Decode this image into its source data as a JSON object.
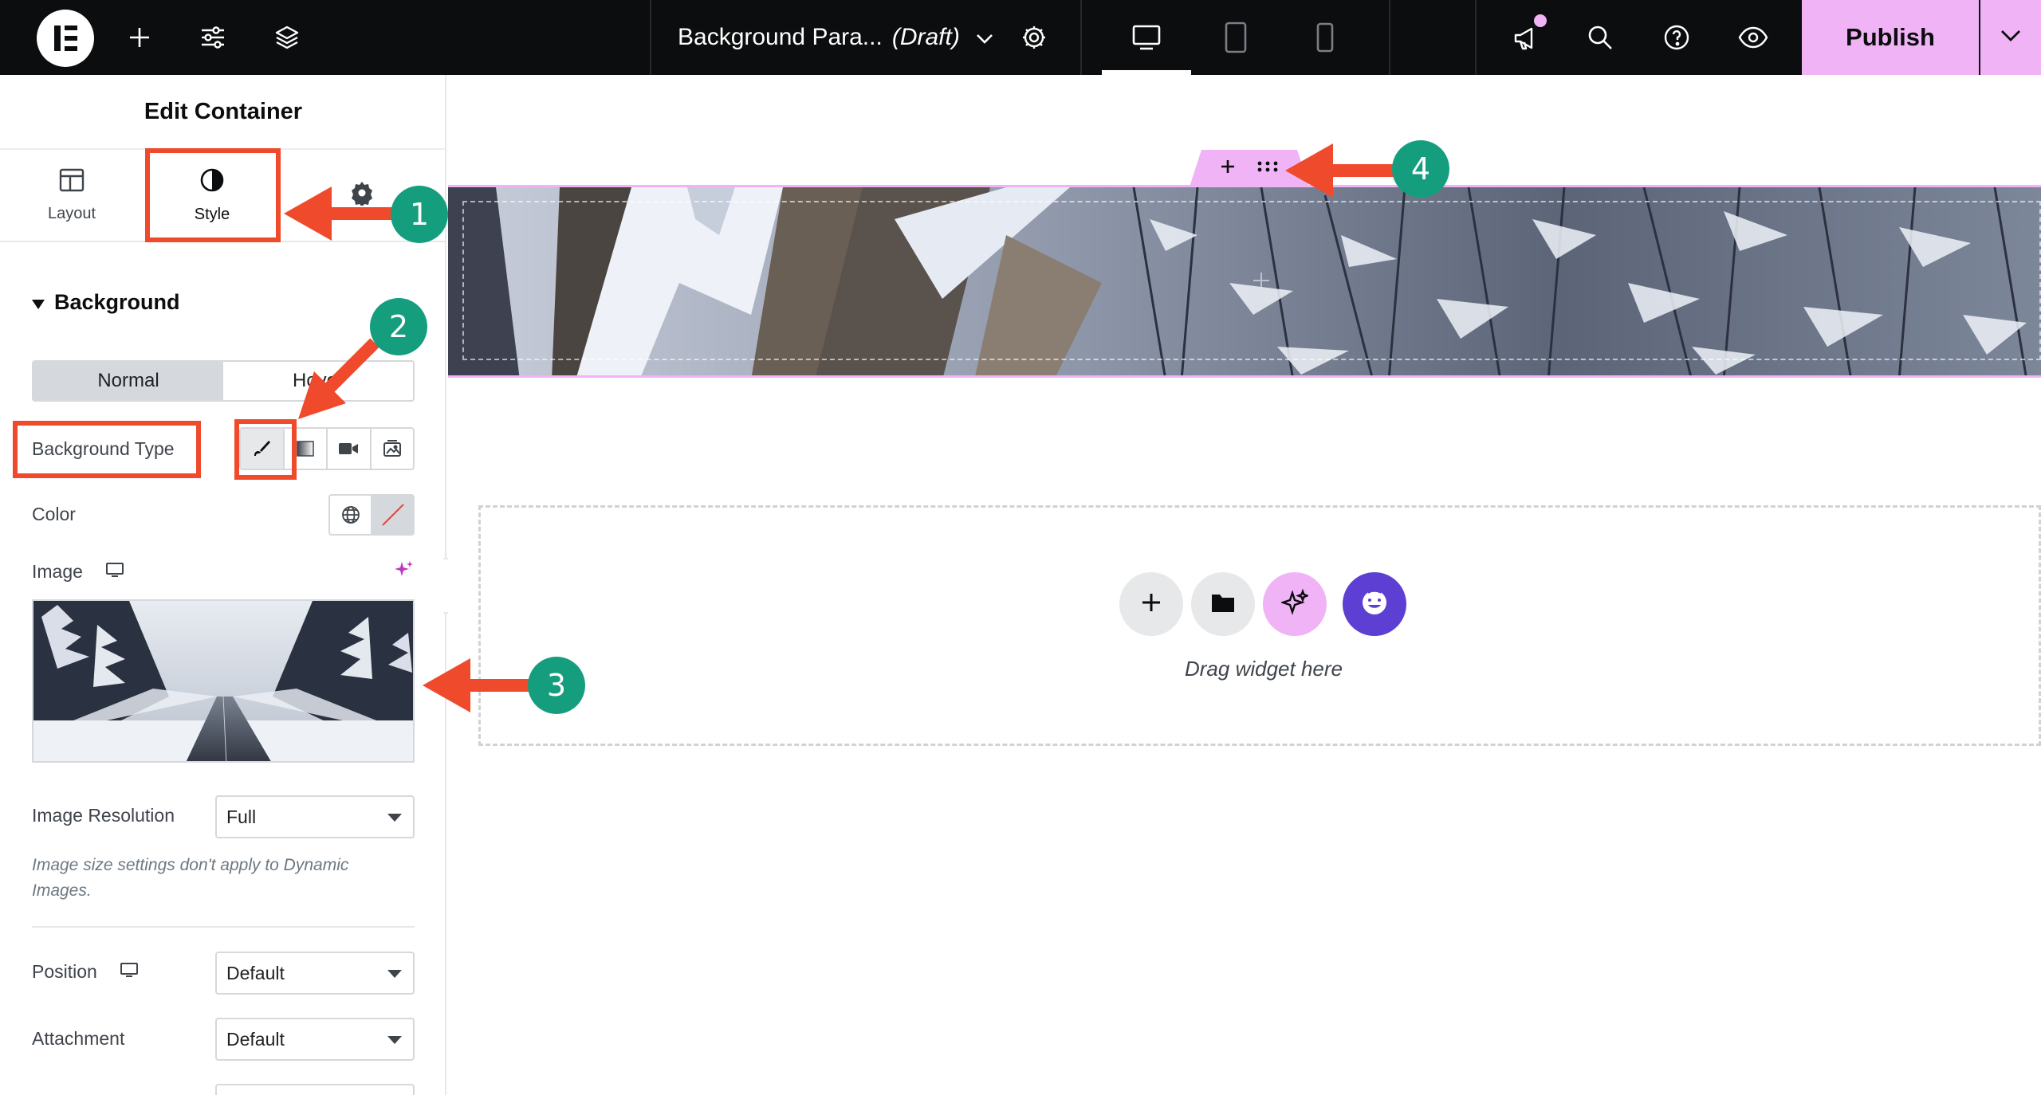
{
  "topbar": {
    "document_title": "Background Para...",
    "draft_label": "(Draft)",
    "publish_label": "Publish"
  },
  "panel": {
    "title": "Edit Container",
    "tabs": [
      {
        "label": "Layout",
        "icon": "layout-icon"
      },
      {
        "label": "Style",
        "icon": "contrast-icon"
      },
      {
        "label": "",
        "icon": "gear-icon"
      }
    ],
    "section": "Background",
    "state_switch": {
      "normal": "Normal",
      "hover": "Hover"
    },
    "background_type_label": "Background Type",
    "color_label": "Color",
    "image_label": "Image",
    "image_resolution_label": "Image Resolution",
    "image_resolution_value": "Full",
    "note": "Image size settings don't apply to Dynamic Images.",
    "position_label": "Position",
    "position_value": "Default",
    "attachment_label": "Attachment",
    "attachment_value": "Default"
  },
  "canvas": {
    "drop_text": "Drag widget here"
  },
  "annotations": {
    "badge_1": "1",
    "badge_2": "2",
    "badge_3": "3",
    "badge_4": "4"
  },
  "colors": {
    "topbar_bg": "#0c0d0e",
    "publish_bg": "#f0b4f6",
    "annotation_red": "#f04a2c",
    "badge_green": "#159e7e",
    "ai_purple": "#5d3fd3"
  }
}
